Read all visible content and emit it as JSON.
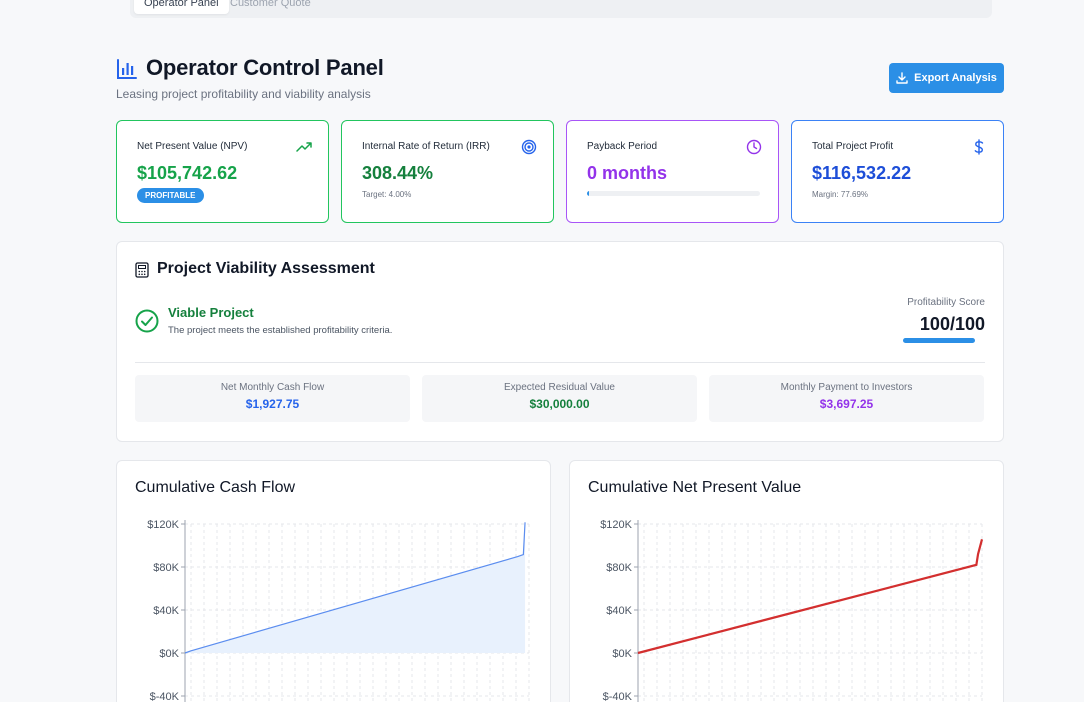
{
  "tabs": [
    {
      "label": "Operator Panel",
      "active": true
    },
    {
      "label": "Customer Quote",
      "active": false
    }
  ],
  "header": {
    "icon": "bar-chart-icon",
    "title": "Operator Control Panel",
    "subtitle": "Leasing project profitability and viability analysis",
    "export_label": "Export Analysis",
    "export_icon": "download-icon"
  },
  "kpis": {
    "npv": {
      "label": "Net Present Value (NPV)",
      "value": "$105,742.62",
      "badge": "PROFITABLE",
      "icon": "trending-up-icon",
      "color": "#16a34a"
    },
    "irr": {
      "label": "Internal Rate of Return (IRR)",
      "value": "308.44%",
      "sub": "Target: 4.00%",
      "icon": "target-icon",
      "color": "#15803d"
    },
    "payback": {
      "label": "Payback Period",
      "value": "0 months",
      "progress": 0.01,
      "icon": "clock-icon",
      "color": "#9333ea"
    },
    "profit": {
      "label": "Total Project Profit",
      "value": "$116,532.22",
      "sub": "Margin: 77.69%",
      "icon": "dollar-icon",
      "color": "#1d4ed8"
    }
  },
  "viability": {
    "title": "Project Viability Assessment",
    "icon": "calculator-icon",
    "status": "Viable Project",
    "description": "The project meets the established profitability criteria.",
    "score_label": "Profitability Score",
    "score": "100/100",
    "score_fraction": 1.0,
    "metrics": [
      {
        "label": "Net Monthly Cash Flow",
        "value": "$1,927.75",
        "color": "#2563eb"
      },
      {
        "label": "Expected Residual Value",
        "value": "$30,000.00",
        "color": "#15803d"
      },
      {
        "label": "Monthly Payment to Investors",
        "value": "$3,697.25",
        "color": "#9333ea"
      }
    ]
  },
  "chart_data": [
    {
      "type": "area",
      "title": "Cumulative Cash Flow",
      "y_ticks": [
        "$120K",
        "$80K",
        "$40K",
        "$0K",
        "$-40K"
      ],
      "y_tick_values": [
        120000,
        80000,
        40000,
        0,
        -40000
      ],
      "ylim": [
        -40000,
        120000
      ],
      "x_months": [
        0,
        1,
        59,
        60,
        60.3
      ],
      "y_values": [
        0,
        1927.75,
        89668,
        91595,
        121595
      ],
      "line_color": "#5b8def",
      "fill_color": "#e8f1fd",
      "grid": true
    },
    {
      "type": "line",
      "title": "Cumulative Net Present Value",
      "y_ticks": [
        "$120K",
        "$80K",
        "$40K",
        "$0K",
        "$-40K"
      ],
      "y_tick_values": [
        120000,
        80000,
        40000,
        0,
        -40000
      ],
      "ylim": [
        -40000,
        120000
      ],
      "x_months": [
        0,
        60,
        60.3,
        61
      ],
      "y_values": [
        0,
        82000,
        92000,
        105742.62
      ],
      "line_color": "#d32f2f",
      "grid": true
    }
  ]
}
